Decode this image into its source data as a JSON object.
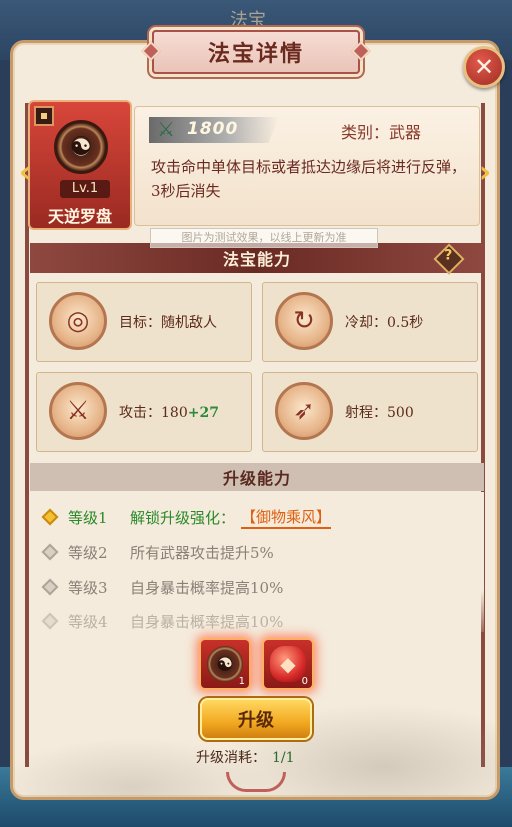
{
  "background": {
    "title_back": "法宝"
  },
  "header": {
    "title": "法宝详情",
    "close_icon": "✕"
  },
  "item": {
    "level": "Lv.1",
    "name": "天逆罗盘",
    "icon": "compass-icon"
  },
  "info": {
    "power": "1800",
    "category": "类别：武器",
    "description": "攻击命中单体目标或者抵达边缘后将进行反弹，3秒后消失"
  },
  "watermark": "图片为测试效果，以线上更新为准",
  "abilities": {
    "title": "法宝能力",
    "help": "?",
    "target": {
      "label": "目标：",
      "value": "随机敌人"
    },
    "cooldown": {
      "label": "冷却：",
      "value": "0.5秒"
    },
    "attack": {
      "label": "攻击：",
      "value": "180",
      "bonus": "+27"
    },
    "range": {
      "label": "射程：",
      "value": "500"
    }
  },
  "upgrade": {
    "title": "升级能力",
    "rows": [
      {
        "level": "等级1",
        "text": "解锁升级强化：",
        "skill": "【御物乘风】",
        "active": true
      },
      {
        "level": "等级2",
        "text": "所有武器攻击提升5%",
        "active": false
      },
      {
        "level": "等级3",
        "text": "自身暴击概率提高10%",
        "active": false
      },
      {
        "level": "等级4",
        "text": "自身暴击概率提高10%",
        "active": false
      }
    ]
  },
  "materials": [
    {
      "icon": "compass-icon",
      "count": "1"
    },
    {
      "icon": "red-gem-icon",
      "count": "0"
    }
  ],
  "action": {
    "button": "升级",
    "cost_label": "升级消耗：",
    "cost_value": "1/1"
  },
  "colors": {
    "accent": "#8e4840",
    "panel": "#f4ebdc",
    "active_green": "#2a8a2a",
    "skill_orange": "#e06010",
    "button_gold": "#f2a820"
  }
}
